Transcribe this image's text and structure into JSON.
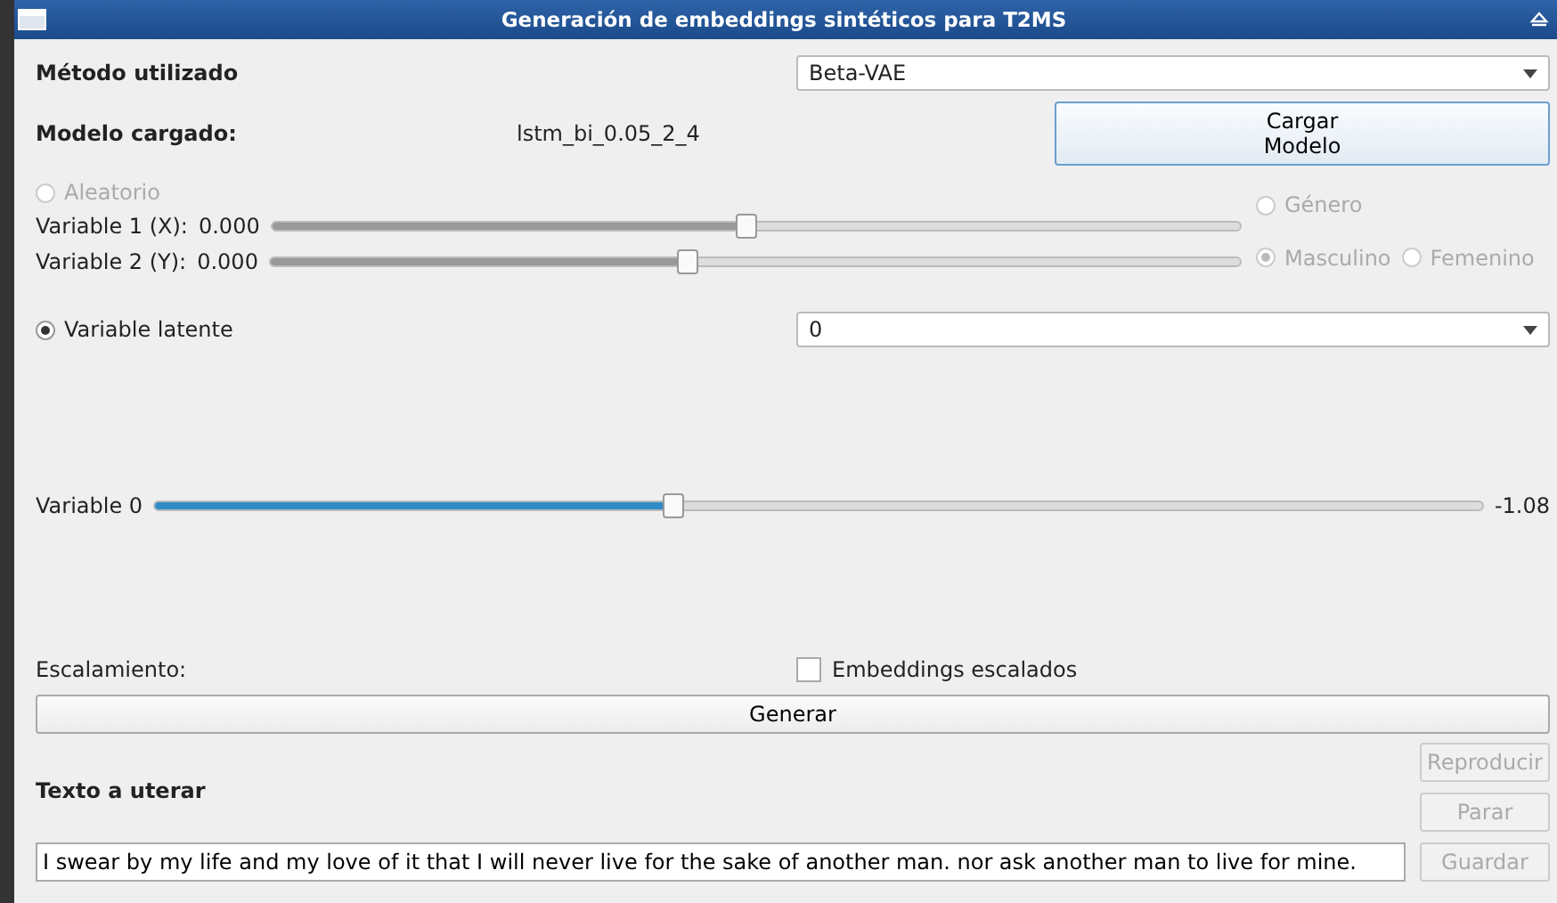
{
  "window": {
    "title": "Generación de embeddings sintéticos para T2MS"
  },
  "method": {
    "label": "Método utilizado",
    "value": "Beta-VAE"
  },
  "model": {
    "label": "Modelo cargado:",
    "value": "lstm_bi_0.05_2_4",
    "button": "Cargar\nModelo"
  },
  "random": {
    "label": "Aleatorio",
    "selected": false,
    "disabled": true
  },
  "xy_sliders": [
    {
      "label": "Variable 1 (X):",
      "reading": "0.000",
      "level": 0.49,
      "disabled": true
    },
    {
      "label": "Variable 2 (Y):",
      "reading": "0.000",
      "level": 0.43,
      "disabled": true
    }
  ],
  "gender": {
    "label": "Género",
    "selected": false,
    "disabled": true,
    "options": [
      {
        "label": "Masculino",
        "selected": true,
        "disabled": true
      },
      {
        "label": "Femenino",
        "selected": false,
        "disabled": true
      }
    ]
  },
  "latent": {
    "label": "Variable latente",
    "selected": true,
    "disabled": false,
    "value": "0"
  },
  "latent_slider": {
    "label": "Variable 0",
    "level": 0.39,
    "reading": "-1.08"
  },
  "scaling": {
    "label": "Escalamiento:",
    "checkbox": "Embeddings escalados",
    "checked": false
  },
  "generate_button": "Generar",
  "utterance": {
    "label": "Texto a uterar",
    "value": "I swear by my life and my love of it that I will never live for the sake of another man. nor ask another man to live for mine."
  },
  "side_buttons": [
    {
      "label": "Reproducir",
      "disabled": true
    },
    {
      "label": "Parar",
      "disabled": true
    },
    {
      "label": "Guardar",
      "disabled": true
    }
  ]
}
